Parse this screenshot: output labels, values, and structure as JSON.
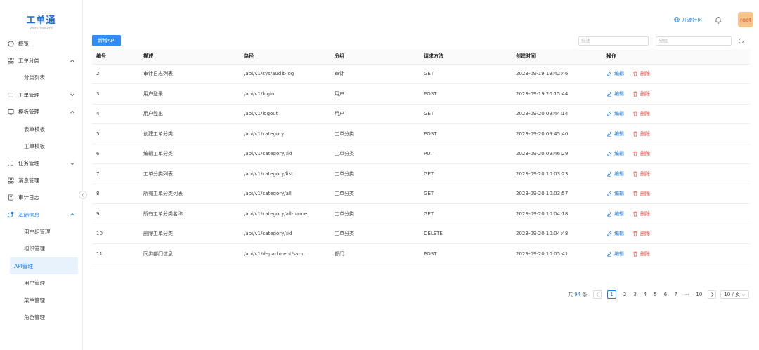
{
  "app": {
    "name": "工单通",
    "subtitle": "Workflow-Pro"
  },
  "sidebar": {
    "items": [
      {
        "label": "概览",
        "icon": "dashboard-icon",
        "type": "top"
      },
      {
        "label": "工单分类",
        "icon": "grid-icon",
        "type": "parent-open"
      },
      {
        "label": "分类列表",
        "type": "child"
      },
      {
        "label": "工单管理",
        "icon": "list-icon",
        "type": "parent-closed"
      },
      {
        "label": "模板管理",
        "icon": "template-icon",
        "type": "parent-open"
      },
      {
        "label": "表单模板",
        "type": "child"
      },
      {
        "label": "工单模板",
        "type": "child"
      },
      {
        "label": "任务管理",
        "icon": "task-icon",
        "type": "parent-closed"
      },
      {
        "label": "消息管理",
        "icon": "grid-icon",
        "type": "top"
      },
      {
        "label": "审计日志",
        "icon": "audit-icon",
        "type": "top"
      },
      {
        "label": "基础信息",
        "icon": "settings-icon",
        "type": "parent-open-active"
      },
      {
        "label": "用户组管理",
        "type": "child"
      },
      {
        "label": "组织管理",
        "type": "child"
      },
      {
        "label": "API管理",
        "type": "child-selected"
      },
      {
        "label": "用户管理",
        "type": "child"
      },
      {
        "label": "菜单管理",
        "type": "child"
      },
      {
        "label": "角色管理",
        "type": "child"
      }
    ]
  },
  "header": {
    "community": "开源社区",
    "user": "root"
  },
  "toolbar": {
    "add_label": "新增API",
    "desc_placeholder": "描述",
    "group_placeholder": "分组"
  },
  "table": {
    "columns": [
      "编号",
      "描述",
      "路径",
      "分组",
      "请求方法",
      "创建时间",
      "操作"
    ],
    "rows": [
      [
        "2",
        "审计日志列表",
        "/api/v1/sys/audit-log",
        "审计",
        "GET",
        "2023-09-19 19:42:46"
      ],
      [
        "3",
        "用户登录",
        "/api/v1/login",
        "用户",
        "POST",
        "2023-09-19 20:15:44"
      ],
      [
        "4",
        "用户登出",
        "/api/v1/logout",
        "用户",
        "GET",
        "2023-09-20 09:44:14"
      ],
      [
        "5",
        "创建工单分类",
        "/api/v1/category",
        "工单分类",
        "POST",
        "2023-09-20 09:45:40"
      ],
      [
        "6",
        "编辑工单分类",
        "/api/v1/category/:id",
        "工单分类",
        "PUT",
        "2023-09-20 09:46:29"
      ],
      [
        "7",
        "工单分类列表",
        "/api/v1/category/list",
        "工单分类",
        "GET",
        "2023-09-20 10:03:23"
      ],
      [
        "8",
        "所有工单分类列表",
        "/api/v1/category/all",
        "工单分类",
        "GET",
        "2023-09-20 10:03:57"
      ],
      [
        "9",
        "所有工单分类名称",
        "/api/v1/category/all-name",
        "工单分类",
        "GET",
        "2023-09-20 10:04:18"
      ],
      [
        "10",
        "删除工单分类",
        "/api/v1/category/:id",
        "工单分类",
        "DELETE",
        "2023-09-20 10:04:48"
      ],
      [
        "11",
        "同步部门信息",
        "/api/v1/department/sync",
        "部门",
        "POST",
        "2023-09-20 10:05:41"
      ]
    ],
    "edit_label": "编辑",
    "delete_label": "删除"
  },
  "pagination": {
    "total_prefix": "共",
    "total": "94",
    "total_suffix": "条",
    "pages": [
      "1",
      "2",
      "3",
      "4",
      "5",
      "6",
      "7",
      "···",
      "10"
    ],
    "current": "1",
    "page_size": "10 / 页"
  },
  "colors": {
    "accent": "#1e7be0",
    "danger": "#e8453c",
    "avatar_bg": "#f6c48a"
  }
}
